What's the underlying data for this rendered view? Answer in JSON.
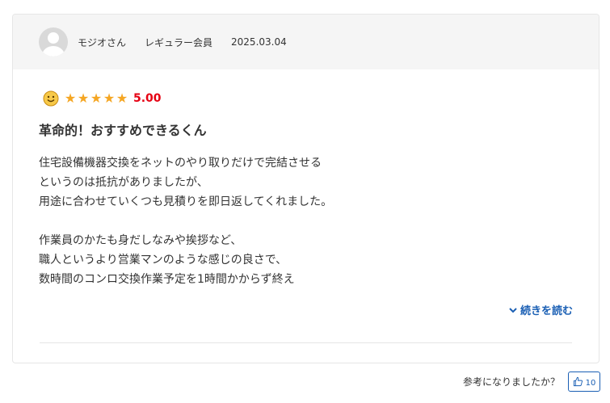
{
  "reviewer": {
    "name": "モジオさん",
    "member_type": "レギュラー会員",
    "date": "2025.03.04",
    "avatar_icon": "user-avatar-icon"
  },
  "rating": {
    "mood_icon": "smiley-face-icon",
    "stars": 5,
    "max_stars": 5,
    "score": "5.00",
    "star_color": "#f5a623",
    "score_color": "#e60012"
  },
  "review": {
    "title": "革命的！おすすめできるくん",
    "lines": [
      "住宅設備機器交換をネットのやり取りだけで完結させる",
      "というのは抵抗がありましたが、",
      "用途に合わせていくつも見積りを即日返してくれました。",
      "",
      "作業員のかたも身だしなみや挨拶など、",
      "職人というより営業マンのような感じの良さで、",
      "数時間のコンロ交換作業予定を1時間かからず終え"
    ],
    "read_more_label": "続きを読む",
    "read_more_icon": "chevron-down-icon"
  },
  "feedback": {
    "question": "参考になりましたか？",
    "like_icon": "thumbs-up-icon",
    "like_count": "10",
    "accent_color": "#1a5fb4"
  }
}
